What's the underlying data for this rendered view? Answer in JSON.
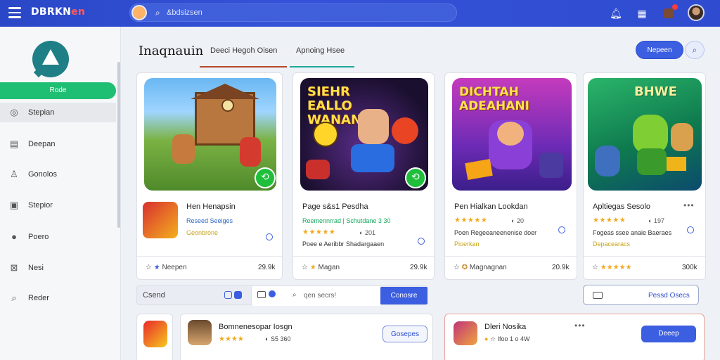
{
  "header": {
    "brand_main": "DBRKN",
    "brand_accent": "en",
    "search_placeholder": "&bdsizsen"
  },
  "sidebar": {
    "home_label": "Rode",
    "items": [
      {
        "label": "Stepian",
        "icon": "compass-icon"
      },
      {
        "label": "Deepan",
        "icon": "document-icon"
      },
      {
        "label": "Gonolos",
        "icon": "user-icon"
      },
      {
        "label": "Stepior",
        "icon": "calendar-icon"
      },
      {
        "label": "Poero",
        "icon": "person-icon"
      },
      {
        "label": "Nesi",
        "icon": "grid-icon"
      },
      {
        "label": "Reder",
        "icon": "search-icon"
      }
    ]
  },
  "main": {
    "title": "Inaqnauin",
    "tabs": [
      "Deeci Hegoh Oisen",
      "Apnoing Hsee"
    ],
    "primary_button": "Nepeen"
  },
  "cards": [
    {
      "art_text": "",
      "name": "Hen Henapsin",
      "line1": "Reseed Seeiges",
      "line2": "Geonbrone",
      "stars": "",
      "rating": "",
      "desc": "",
      "foot_left": "Neepen",
      "foot_right": "29.9k"
    },
    {
      "art_text": "SIEHR EALLO WANAN!",
      "name": "Page s&s1 Pesdha",
      "line1": "Reemennrrad | Schutdane 3 30",
      "line2": "",
      "stars": "★★★★★",
      "rating": "201",
      "desc": "Poee e Aeribbr Shadargaaen",
      "foot_left": "Magan",
      "foot_right": "29.9k"
    },
    {
      "art_text": "DICHTAH ADEAHANI",
      "name": "Pen Hialkan Lookdan",
      "line1": "",
      "line2": "",
      "stars": "★★★★★",
      "rating": "20",
      "desc": "Poen Regeeaneenenise doer",
      "line3": "Pioerkan",
      "foot_left": "Magnagnan",
      "foot_right": "20.9k"
    },
    {
      "art_text": "BHWE",
      "name": "Apltiegas Sesolo",
      "line1": "",
      "line2": "",
      "stars": "★★★★★",
      "rating": "197",
      "desc": "Fogeas ssee anaie Baeraes",
      "line3": "Depacearacs",
      "foot_left": "★★★★★",
      "foot_right": "300k"
    }
  ],
  "filter": {
    "label": "Csend",
    "search_text": "qen secrs!",
    "go_label": "Conosre"
  },
  "outline_button": "Pessd Osecs",
  "bottom": [
    {
      "name": "Bomnenesopar Iosgn",
      "stars": "★★★★",
      "sub": "S5 360",
      "button": "Gosepes"
    },
    {
      "name": "Dleri Nosika",
      "sub": "Ifoo 1 o 4W",
      "button": "Deeep"
    }
  ],
  "colors": {
    "topbar": "#2f4cd0",
    "accent_blue": "#3c5ee0",
    "accent_green": "#1fbf73",
    "star": "#f3a81c"
  }
}
